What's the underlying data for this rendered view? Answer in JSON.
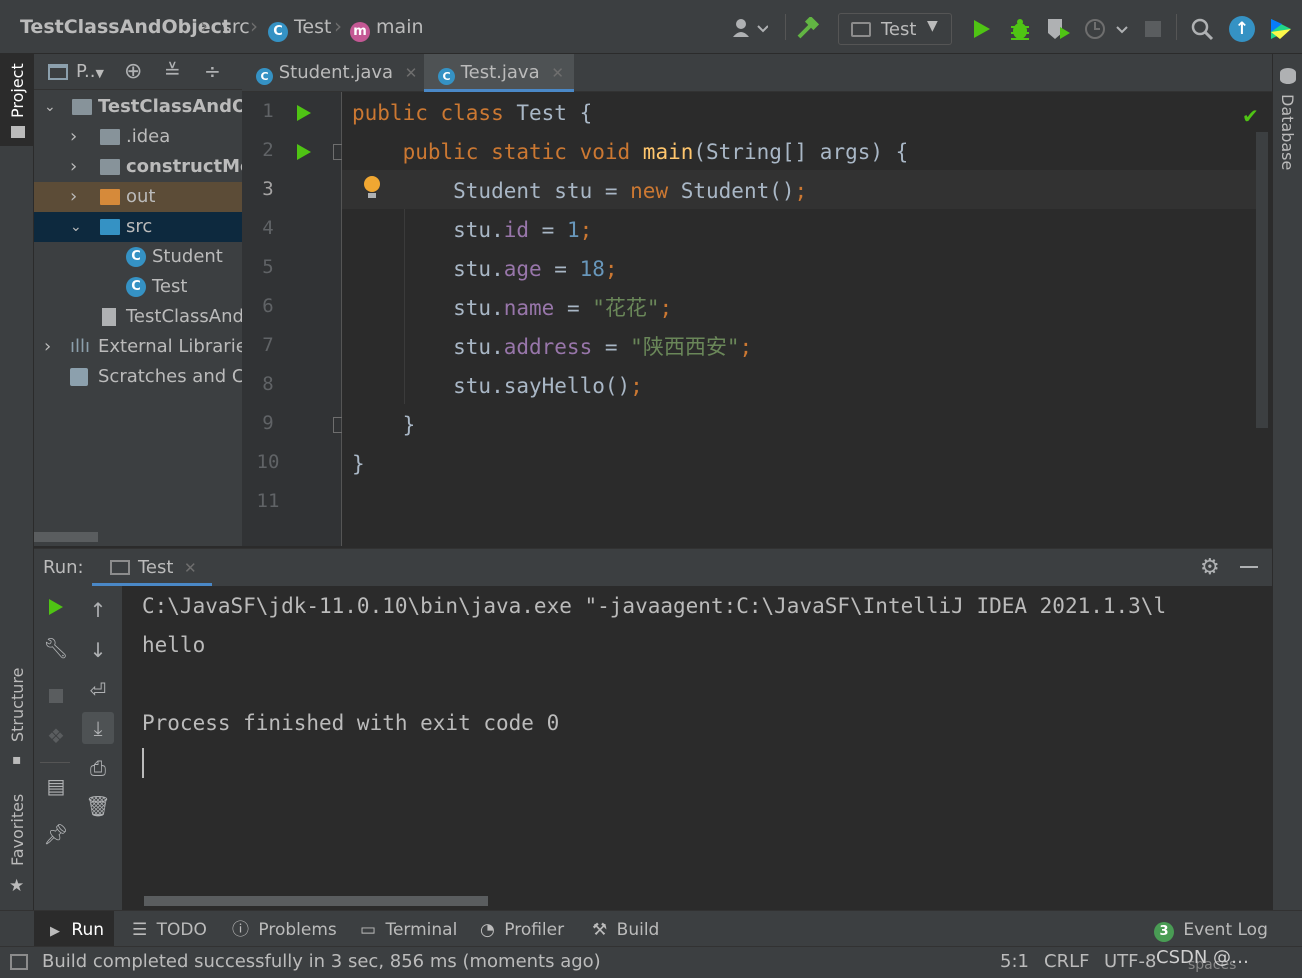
{
  "breadcrumb": {
    "project": "TestClassAndObject",
    "folder": "src",
    "cls": "Test",
    "method": "main",
    "class_badge": "C",
    "method_badge": "m"
  },
  "toolbar": {
    "run_config": "Test",
    "icons": [
      "user-icon",
      "hammer-icon",
      "run-icon",
      "debug-icon",
      "coverage-icon",
      "profile-icon",
      "stop-icon",
      "search-icon",
      "update-icon",
      "plugin-icon"
    ]
  },
  "left_strip": {
    "project": "Project",
    "structure": "Structure",
    "favorites": "Favorites"
  },
  "right_strip": {
    "database": "Database"
  },
  "project_panel": {
    "title": "P..",
    "tree": [
      {
        "label": "TestClassAndOb",
        "bold": true
      },
      {
        "label": ".idea"
      },
      {
        "label": "constructMe",
        "bold": true
      },
      {
        "label": "out"
      },
      {
        "label": "src"
      },
      {
        "label": "Student"
      },
      {
        "label": "Test"
      },
      {
        "label": "TestClassAnd"
      },
      {
        "label": "External Libraries"
      },
      {
        "label": "Scratches and Co"
      }
    ]
  },
  "editor": {
    "tabs": [
      {
        "label": "Student.java",
        "active": false
      },
      {
        "label": "Test.java",
        "active": true
      }
    ],
    "line_numbers": [
      "1",
      "2",
      "3",
      "4",
      "5",
      "6",
      "7",
      "8",
      "9",
      "10",
      "11"
    ],
    "lines": [
      [
        [
          "kw",
          "public class "
        ],
        [
          "",
          "Test {"
        ]
      ],
      [
        [
          "",
          "    "
        ],
        [
          "kw",
          "public static void "
        ],
        [
          "fn",
          "main"
        ],
        [
          "",
          "(String[] args) {"
        ]
      ],
      [
        [
          "",
          "        Student stu = "
        ],
        [
          "kw",
          "new "
        ],
        [
          "",
          "Student()"
        ],
        [
          "kw",
          ";"
        ]
      ],
      [
        [
          "",
          "        stu."
        ],
        [
          "fld",
          "id"
        ],
        [
          "",
          " = "
        ],
        [
          "num",
          "1"
        ],
        [
          "kw",
          ";"
        ]
      ],
      [
        [
          "",
          "        stu."
        ],
        [
          "fld",
          "age"
        ],
        [
          "",
          " = "
        ],
        [
          "num",
          "18"
        ],
        [
          "kw",
          ";"
        ]
      ],
      [
        [
          "",
          "        stu."
        ],
        [
          "fld",
          "name"
        ],
        [
          "",
          " = "
        ],
        [
          "str",
          "\"花花\""
        ],
        [
          "kw",
          ";"
        ]
      ],
      [
        [
          "",
          "        stu."
        ],
        [
          "fld",
          "address"
        ],
        [
          "",
          " = "
        ],
        [
          "str",
          "\"陕西西安\""
        ],
        [
          "kw",
          ";"
        ]
      ],
      [
        [
          "",
          "        stu.sayHello()"
        ],
        [
          "kw",
          ";"
        ]
      ],
      [
        [
          "",
          "    }"
        ]
      ],
      [
        [
          "",
          "}"
        ]
      ],
      [
        [
          "",
          ""
        ]
      ]
    ]
  },
  "run_panel": {
    "label": "Run:",
    "tab": "Test",
    "output": [
      "C:\\JavaSF\\jdk-11.0.10\\bin\\java.exe \"-javaagent:C:\\JavaSF\\IntelliJ IDEA 2021.1.3\\l",
      "hello",
      "",
      "Process finished with exit code 0"
    ]
  },
  "bottom_tabs": [
    {
      "label": "Run"
    },
    {
      "label": "TODO"
    },
    {
      "label": "Problems"
    },
    {
      "label": "Terminal"
    },
    {
      "label": "Profiler"
    },
    {
      "label": "Build"
    }
  ],
  "event_log": {
    "count": "3",
    "label": "Event Log"
  },
  "status": {
    "message": "Build completed successfully in 3 sec, 856 ms (moments ago)",
    "position": "5:1",
    "line_sep": "CRLF",
    "encoding": "UTF-8",
    "watermark": "CSDN @…",
    "indent": "spaces"
  },
  "colors": {
    "keyword": "#cc7832",
    "field": "#9876aa",
    "number": "#6897bb",
    "string": "#6a8759",
    "method": "#ffc66d",
    "run_green": "#4fc414",
    "badge_blue": "#3592c4",
    "selection": "#0d293e"
  }
}
